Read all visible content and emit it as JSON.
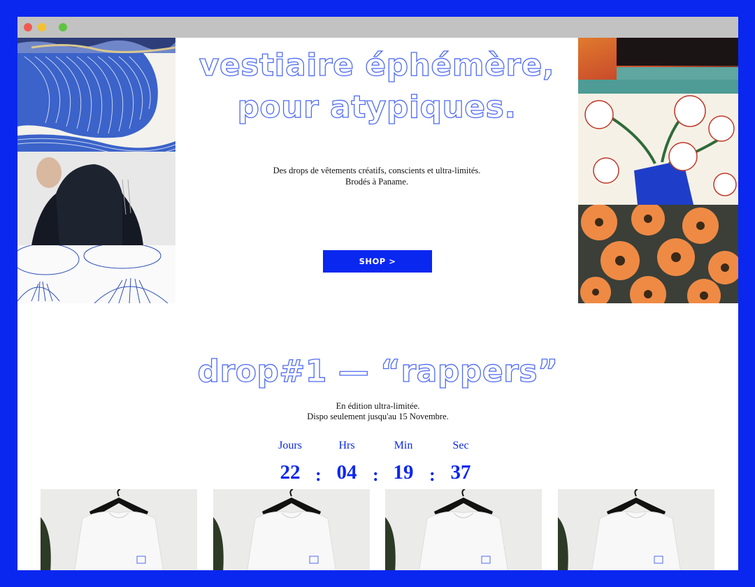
{
  "window": {
    "controls": [
      "close",
      "minimize",
      "maximize"
    ]
  },
  "hero": {
    "title_line1": "vestiaire éphémère,",
    "title_line2": "pour atypiques.",
    "subtitle_line1": "Des drops de vêtements créatifs, conscients et ultra-limités.",
    "subtitle_line2": "Brodés à Paname.",
    "shop_label": "SHOP >"
  },
  "drop": {
    "title": "drop#1 — “rappers”",
    "subtitle_line1": "En édition ultra-limitée.",
    "subtitle_line2": "Dispo seulement jusqu'au 15 Novembre."
  },
  "countdown": {
    "units": [
      {
        "label": "Jours",
        "value": "22"
      },
      {
        "label": "Hrs",
        "value": "04"
      },
      {
        "label": "Min",
        "value": "19"
      },
      {
        "label": "Sec",
        "value": "37"
      }
    ],
    "separator": ":"
  },
  "products": [
    {
      "image": "white-tshirt-on-hanger"
    },
    {
      "image": "white-tshirt-on-hanger"
    },
    {
      "image": "white-tshirt-on-hanger"
    },
    {
      "image": "white-tshirt-on-hanger"
    }
  ],
  "colors": {
    "brand_blue": "#0a27f0",
    "outline_blue": "#4f6bf2",
    "frame_gray": "#c2c2c2"
  }
}
